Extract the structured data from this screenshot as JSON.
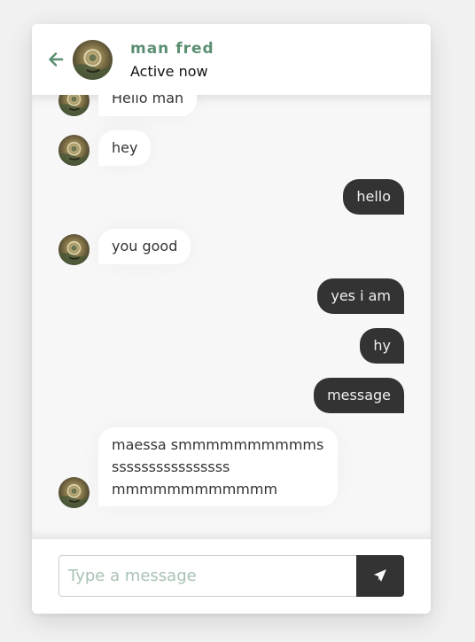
{
  "header": {
    "back_icon": "arrow-left-icon",
    "avatar_icon": "user-avatar",
    "name": "man fred",
    "status": "Active now"
  },
  "messages": [
    {
      "direction": "incoming",
      "text": "Hello man"
    },
    {
      "direction": "incoming",
      "text": "hey"
    },
    {
      "direction": "outgoing",
      "text": "hello"
    },
    {
      "direction": "incoming",
      "text": "you good"
    },
    {
      "direction": "outgoing",
      "text": "yes i am"
    },
    {
      "direction": "outgoing",
      "text": "hy"
    },
    {
      "direction": "outgoing",
      "text": "message"
    },
    {
      "direction": "incoming",
      "lines": [
        "maessa smmmmmmmmmms",
        "ssssssssssssssss",
        "mmmmmmmmmmmm"
      ]
    }
  ],
  "composer": {
    "placeholder": "Type a message",
    "value": "",
    "send_icon": "paper-plane-icon"
  },
  "colors": {
    "accent": "#5b8f72",
    "outgoing_bubble": "#333333",
    "incoming_bubble": "#ffffff",
    "chat_background": "#f7f7f7",
    "page_background": "#f1f1f1"
  }
}
